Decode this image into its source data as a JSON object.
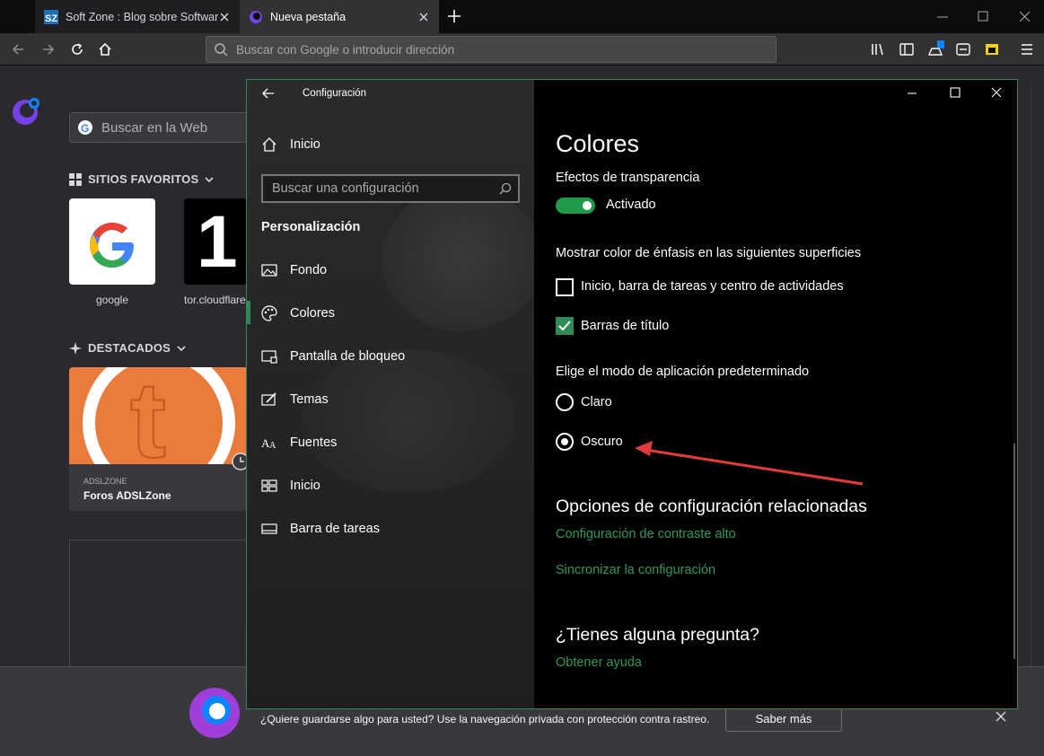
{
  "browser": {
    "tabs": [
      {
        "title": "Soft Zone : Blog sobre Software",
        "favicon": "sz-icon"
      },
      {
        "title": "Nueva pestaña",
        "favicon": "firefox-icon"
      }
    ],
    "url_placeholder": "Buscar con Google o introducir dirección"
  },
  "newtab": {
    "search_placeholder": "Buscar en la Web",
    "favorites_heading": "SITIOS FAVORITOS",
    "tiles": [
      {
        "label": "google"
      },
      {
        "label": "tor.cloudflare"
      },
      {
        "glyph": "1"
      }
    ],
    "featured_heading": "DESTACADOS",
    "card": {
      "source": "ADSLZONE",
      "title": "Foros ADSLZone",
      "logo_letter": "t"
    },
    "bottom_bar": {
      "text": "¿Quiere guardarse algo para usted? Use la navegación privada con protección contra rastreo.",
      "button": "Saber más"
    }
  },
  "settings": {
    "window_title": "Configuración",
    "nav_home": "Inicio",
    "search_placeholder": "Buscar una configuración",
    "section": "Personalización",
    "nav_items": [
      {
        "label": "Fondo",
        "icon": "image-icon"
      },
      {
        "label": "Colores",
        "icon": "palette-icon"
      },
      {
        "label": "Pantalla de bloqueo",
        "icon": "lock-screen-icon"
      },
      {
        "label": "Temas",
        "icon": "themes-icon"
      },
      {
        "label": "Fuentes",
        "icon": "fonts-icon"
      },
      {
        "label": "Inicio",
        "icon": "start-icon"
      },
      {
        "label": "Barra de tareas",
        "icon": "taskbar-icon"
      }
    ],
    "selected": "Colores",
    "page_title": "Colores",
    "transparency_label": "Efectos de transparencia",
    "transparency_state": "Activado",
    "accent_label": "Mostrar color de énfasis en las siguientes superficies",
    "accent_options": [
      {
        "label": "Inicio, barra de tareas y centro de actividades",
        "checked": false
      },
      {
        "label": "Barras de título",
        "checked": true
      }
    ],
    "mode_label": "Elige el modo de aplicación predeterminado",
    "mode_options": [
      {
        "label": "Claro",
        "selected": false
      },
      {
        "label": "Oscuro",
        "selected": true
      }
    ],
    "related_heading": "Opciones de configuración relacionadas",
    "related_links": [
      "Configuración de contraste alto",
      "Sincronizar la configuración"
    ],
    "question_heading": "¿Tienes alguna pregunta?",
    "help_link": "Obtener ayuda",
    "accent_color": "#2e8b57"
  }
}
